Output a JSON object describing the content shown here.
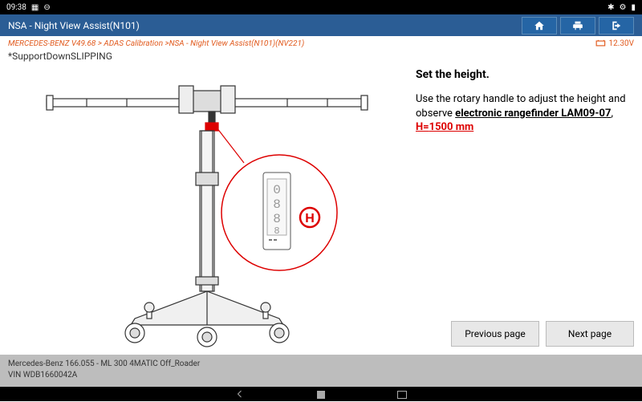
{
  "status": {
    "time": "09:38",
    "bt": true,
    "wifi": false
  },
  "header": {
    "title": "NSA - Night View Assist(N101)"
  },
  "breadcrumb": "MERCEDES-BENZ V49.68 > ADAS Calibration >NSA - Night View Assist(N101)(NV221)",
  "voltage": "12.30V",
  "subtitle": "*SupportDownSLIPPING",
  "instr": {
    "heading": "Set the height.",
    "body1": "Use the rotary handle to adjust the height and observe ",
    "link": "electronic rangefinder LAM09-07",
    "body2": ", ",
    "hlabel": "H=",
    "hvalue": "1500 mm"
  },
  "buttons": {
    "prev": "Previous page",
    "next": "Next page"
  },
  "footer": {
    "line1": "Mercedes-Benz 166.055 - ML 300 4MATIC Off_Roader",
    "line2": "VIN WDB1660042A"
  },
  "display": "0888"
}
